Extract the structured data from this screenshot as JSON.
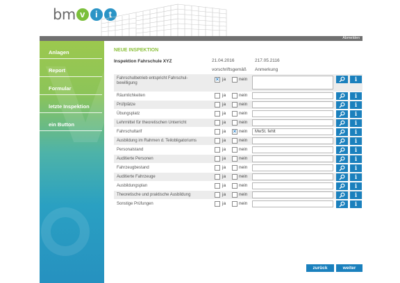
{
  "header": {
    "logo": {
      "part1": "bm",
      "c1": "v",
      "c2": "i",
      "c3": "t"
    },
    "logout_label": "Abmelden"
  },
  "sidebar": {
    "items": [
      {
        "label": "Anlagen"
      },
      {
        "label": "Report"
      },
      {
        "label": "Formular"
      },
      {
        "label": "letzte Inspektion"
      },
      {
        "label": "ein Button"
      }
    ]
  },
  "main": {
    "section_title": "NEUE INSPEKTION",
    "form_title": "Inspektion Fahrschule XYZ",
    "date1": "21.04.2016",
    "date2": "217.05.2116",
    "col_compliant": "vorschriftsgemäß",
    "col_remark": "Anmerkung",
    "yes_label": "ja",
    "no_label": "nein",
    "rows": [
      {
        "label": "Fahrschulbetrieb entspricht Fahrschul-\nbewilligung",
        "yes": true,
        "no": false,
        "remark": ""
      },
      {
        "label": "Räumlichkeiten",
        "yes": false,
        "no": false,
        "remark": ""
      },
      {
        "label": "Prüfplätze",
        "yes": false,
        "no": false,
        "remark": ""
      },
      {
        "label": "Übungsplatz",
        "yes": false,
        "no": false,
        "remark": ""
      },
      {
        "label": "Lehrmittel für theoretischen Unterricht",
        "yes": false,
        "no": false,
        "remark": ""
      },
      {
        "label": "Fahrschultarif",
        "yes": false,
        "no": true,
        "remark": "MwSt. fehlt"
      },
      {
        "label": "Ausbildung im Rahmen d. Teilobligatoriums",
        "yes": false,
        "no": false,
        "remark": ""
      },
      {
        "label": "Personalstand",
        "yes": false,
        "no": false,
        "remark": ""
      },
      {
        "label": "Auditierte Personen",
        "yes": false,
        "no": false,
        "remark": ""
      },
      {
        "label": "Fahrzeugbestand",
        "yes": false,
        "no": false,
        "remark": ""
      },
      {
        "label": "Auditierte Fahrzeuge",
        "yes": false,
        "no": false,
        "remark": ""
      },
      {
        "label": "Ausbildungsplan",
        "yes": false,
        "no": false,
        "remark": ""
      },
      {
        "label": "Theoretische und  praktische Ausbildung",
        "yes": false,
        "no": false,
        "remark": ""
      },
      {
        "label": "Sonstige Prüfungen",
        "yes": false,
        "no": false,
        "remark": ""
      }
    ]
  },
  "footer": {
    "back_label": "zurück",
    "next_label": "weiter"
  },
  "icons": {
    "search": "search-icon",
    "info": "info-icon"
  },
  "colors": {
    "accent_green": "#8cc03c",
    "button_blue": "#1a80bd",
    "topbar_gray": "#707070",
    "check_blue": "#2a7fc4"
  }
}
